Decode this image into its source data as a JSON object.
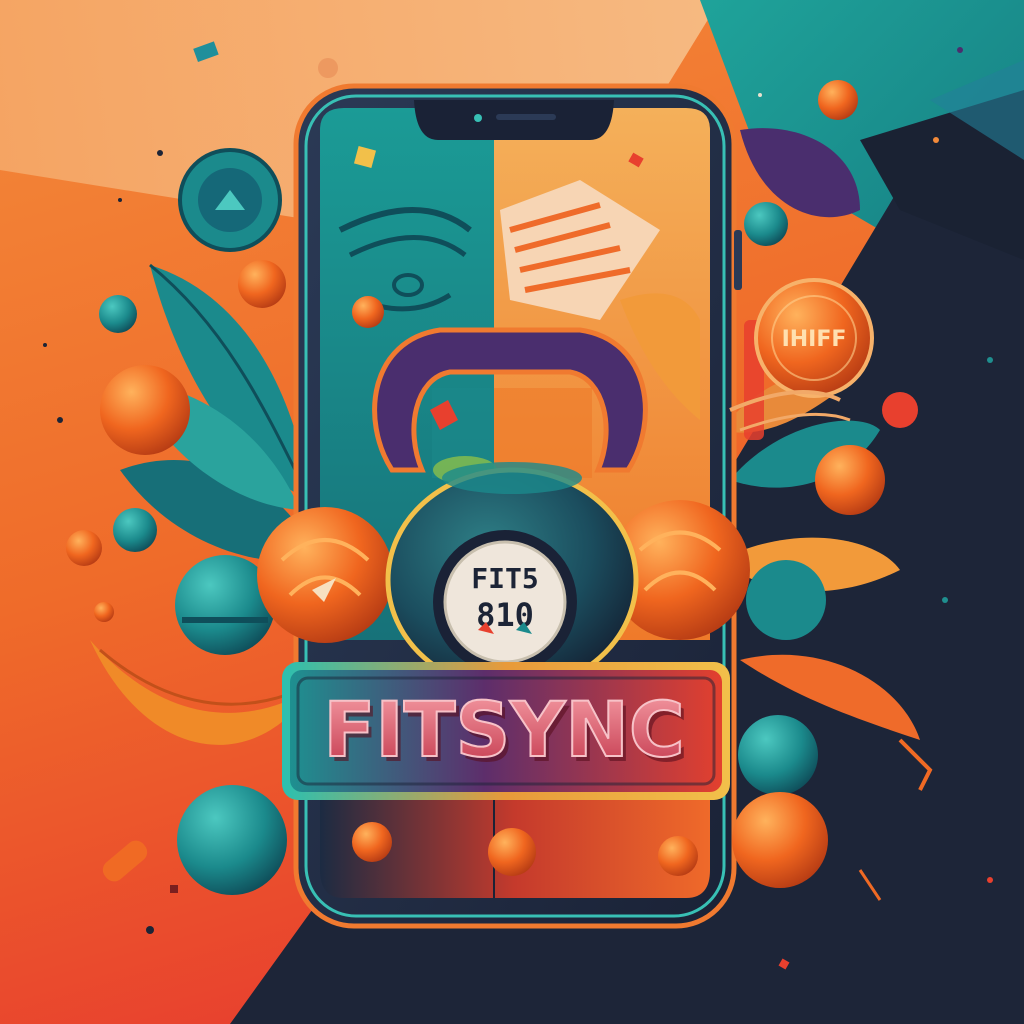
{
  "brand": {
    "title": "FITSYNC",
    "dial_line1": "FIT5",
    "dial_line2": "810",
    "sticker_text": "IHIFF"
  },
  "colors": {
    "orange": "#f06a24",
    "teal": "#1f8f8f",
    "navy": "#1c2436",
    "peach": "#f2a968",
    "red": "#e8402e",
    "purple": "#4a2e6e"
  }
}
